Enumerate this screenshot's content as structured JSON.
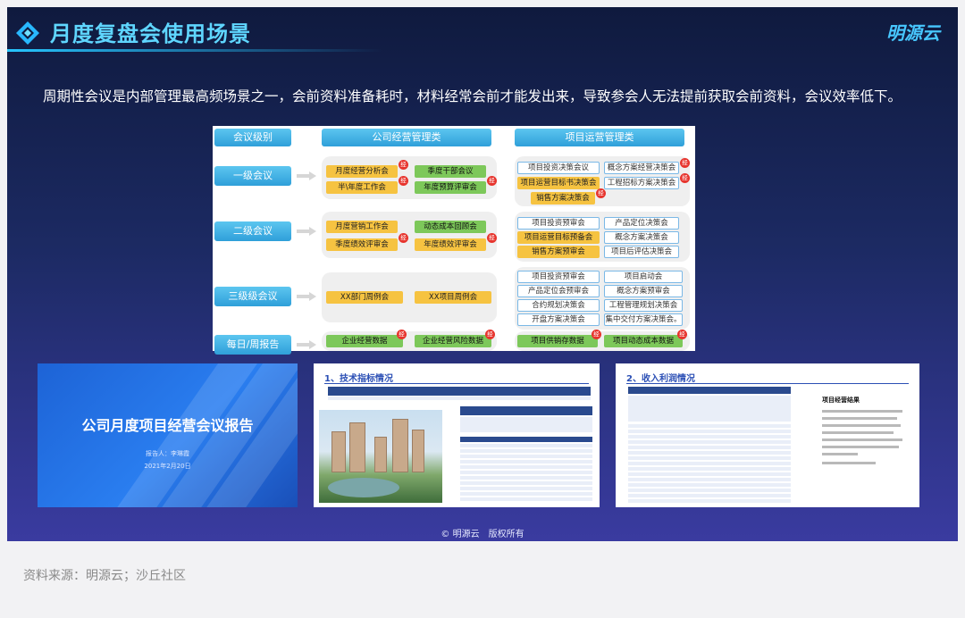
{
  "header": {
    "title": "月度复盘会使用场景",
    "brand": "明源云",
    "icon": "diamond-logo-icon",
    "accent": "#5fd6ff"
  },
  "intro": "周期性会议是内部管理最高频场景之一，会前资料准备耗时，材料经常会前才能发出来，导致参会人无法提前获取会前资料，会议效率低下。",
  "matrix": {
    "columns": [
      "会议级别",
      "公司经营管理类",
      "项目运营管理类"
    ],
    "levels": [
      "一级会议",
      "二级会议",
      "三级级会议",
      "每日/周报告"
    ],
    "badge_text": "经",
    "company": {
      "l1": [
        "月度经营分析会",
        "季度干部会议",
        "半\\年度工作会",
        "年度预算评审会"
      ],
      "l2": [
        "月度营销工作会",
        "动态成本回顾会",
        "季度绩效评审会",
        "年度绩效评审会"
      ],
      "l3": [
        "XX部门周例会",
        "XX项目周例会"
      ],
      "l4": [
        "企业经营数据",
        "企业经营风险数据"
      ]
    },
    "project": {
      "l1": [
        "项目投资决策会议",
        "概念方案经营决策会",
        "项目运营目标书决策会",
        "工程招标方案决策会",
        "销售方案决策会"
      ],
      "l2": [
        "项目投资预审会",
        "产品定位决策会",
        "项目运营目标预备会",
        "概念方案决策会",
        "销售方案预审会",
        "项目后评估决策会"
      ],
      "l3": [
        "项目投资预审会",
        "项目启动会",
        "产品定位会预审会",
        "概念方案预审会",
        "合约规划决策会",
        "工程管理规划决策会",
        "开盘方案决策会",
        "集中交付方案决策会。"
      ],
      "l4": [
        "项目供销存数据",
        "项目动态成本数据"
      ]
    },
    "colors": {
      "yellow": "#f6c341",
      "green": "#7dc85a",
      "blue": "#3aa8e2",
      "badge": "#e7342d"
    }
  },
  "thumbnails": {
    "report": {
      "title": "公司月度项目经营会议报告",
      "reporter": "报告人：李琳霞",
      "date": "2021年2月20日"
    },
    "tech": {
      "section": "1、技术指标情况"
    },
    "income": {
      "section": "2、收入利润情况",
      "side_title": "项目经营结果"
    }
  },
  "footer": {
    "copyright": "© 明源云　版权所有",
    "source": "资料来源：明源云；沙丘社区"
  }
}
